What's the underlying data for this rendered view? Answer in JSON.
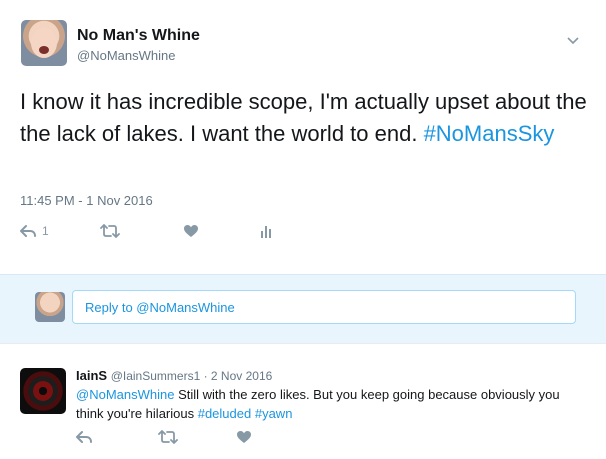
{
  "tweet": {
    "author_name": "No Man's Whine",
    "author_handle": "@NoMansWhine",
    "text_plain": "I know it has incredible scope, I'm actually upset about the the lack of lakes. I want the world to end. ",
    "hashtag": "#NoMansSky",
    "timestamp": "11:45 PM - 1 Nov 2016",
    "reply_count": "1"
  },
  "reply_box": {
    "placeholder": "Reply to @NoMansWhine"
  },
  "reply": {
    "author_name": "IainS",
    "author_meta": "@IainSummers1 · 2 Nov 2016",
    "mention": "@NoMansWhine",
    "text": " Still with the zero likes. But you keep going because obviously you think you're hilarious ",
    "hashtag1": "#deluded",
    "hashtag2": "#yawn"
  },
  "icons": {
    "reply": "reply-icon",
    "retweet": "retweet-icon",
    "like": "heart-icon",
    "analytics": "analytics-icon",
    "menu": "chevron-down-icon"
  },
  "colors": {
    "link": "#1b95e0",
    "muted": "#657786",
    "icon": "#8899a6",
    "reply_bar_bg": "#e8f5fd"
  }
}
